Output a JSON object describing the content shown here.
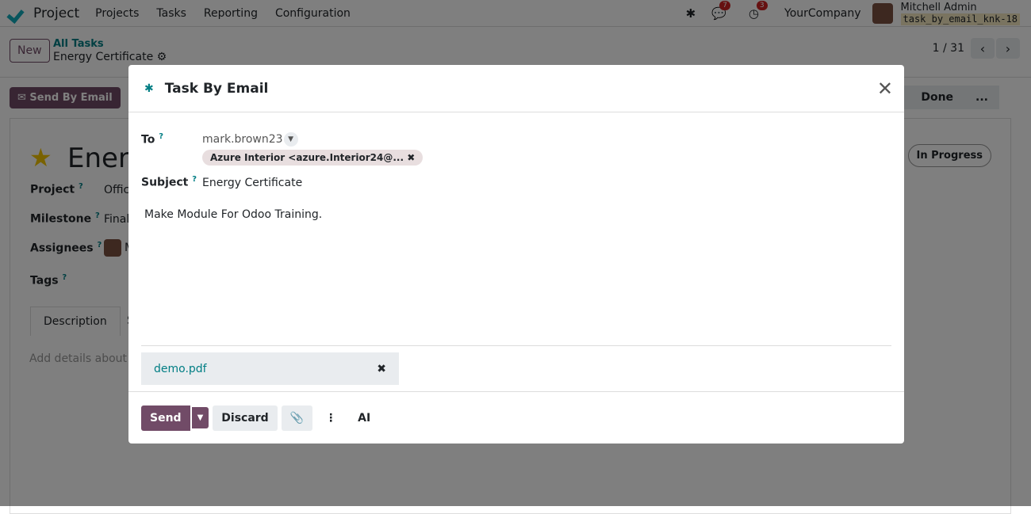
{
  "navbar": {
    "app": "Project",
    "menu": [
      "Projects",
      "Tasks",
      "Reporting",
      "Configuration"
    ],
    "messages_count": "7",
    "activities_count": "3",
    "company": "YourCompany",
    "user": "Mitchell Admin",
    "database": "task_by_email_knk-18"
  },
  "control": {
    "new_label": "New",
    "breadcrumb_parent": "All Tasks",
    "breadcrumb_current": "Energy Certificate",
    "pager": "1 / 31"
  },
  "form": {
    "send_by_email": "Send By Email",
    "stages": [
      "n",
      "Done",
      "..."
    ],
    "title": "Energ",
    "state": "In Progress",
    "fields": [
      {
        "label": "Project",
        "value": "Offic"
      },
      {
        "label": "Milestone",
        "value": "Final"
      },
      {
        "label": "Assignees",
        "value": "M"
      },
      {
        "label": "Tags",
        "value": ""
      }
    ],
    "tabs": [
      "Description",
      "S"
    ],
    "description_placeholder": "Add details about th"
  },
  "modal": {
    "title": "Task By Email",
    "to_label": "To",
    "to_value": "mark.brown23",
    "recipient_chip": "Azure Interior <azure.Interior24@...",
    "subject_label": "Subject",
    "subject_value": "Energy Certificate",
    "body": "Make Module For Odoo Training.",
    "attachment": "demo.pdf",
    "help": "?",
    "buttons": {
      "send": "Send",
      "discard": "Discard",
      "ai": "AI"
    }
  },
  "colors": {
    "primary": "#714b67",
    "accent": "#017e84"
  }
}
